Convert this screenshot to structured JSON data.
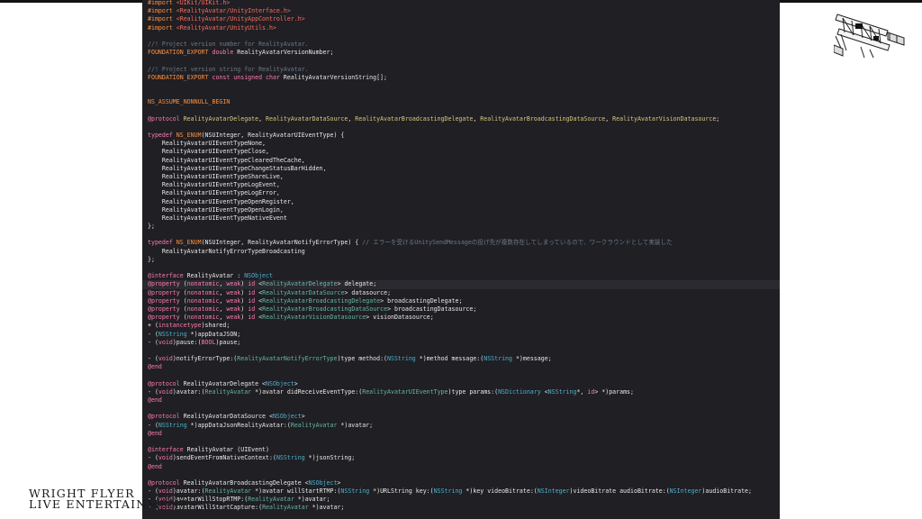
{
  "brand": {
    "line1": "WRIGHT FLYER",
    "line2": "LIVE ENTERTAINMENT"
  },
  "icons": {
    "logo": "biplane-logo-icon"
  },
  "colors": {
    "editor_bg": "#1f1f24",
    "keyword": "#ff7ab2",
    "macro": "#fd8f3f",
    "string": "#fc6a5d",
    "comment": "#6c7986",
    "type": "#4eb0cc",
    "class": "#d9c97c"
  },
  "code_lines": [
    [
      [
        "mac",
        "#import "
      ],
      [
        "str",
        "<UIKit/UIKit.h>"
      ]
    ],
    [
      [
        "mac",
        "#import "
      ],
      [
        "str",
        "<RealityAvatar/UnityInterface.h>"
      ]
    ],
    [
      [
        "mac",
        "#import "
      ],
      [
        "str",
        "<RealityAvatar/UnityAppController.h>"
      ]
    ],
    [
      [
        "mac",
        "#import "
      ],
      [
        "str",
        "<RealityAvatar/UnityUtils.h>"
      ]
    ],
    [],
    [
      [
        "cmt",
        "//! Project version number for RealityAvatar."
      ]
    ],
    [
      [
        "mac",
        "FOUNDATION_EXPORT "
      ],
      [
        "kw",
        "double "
      ],
      [
        "pl",
        "RealityAvatarVersionNumber;"
      ]
    ],
    [],
    [
      [
        "cmt",
        "//! Project version string for RealityAvatar."
      ]
    ],
    [
      [
        "mac",
        "FOUNDATION_EXPORT "
      ],
      [
        "kw",
        "const unsigned char "
      ],
      [
        "pl",
        "RealityAvatarVersionString[];"
      ]
    ],
    [],
    [],
    [
      [
        "mac",
        "NS_ASSUME_NONNULL_BEGIN"
      ]
    ],
    [],
    [
      [
        "kw",
        "@protocol "
      ],
      [
        "cls",
        "RealityAvatarDelegate"
      ],
      [
        "pl",
        ", "
      ],
      [
        "cls",
        "RealityAvatarDataSource"
      ],
      [
        "pl",
        ", "
      ],
      [
        "cls",
        "RealityAvatarBroadcastingDelegate"
      ],
      [
        "pl",
        ", "
      ],
      [
        "cls",
        "RealityAvatarBroadcastingDataSource"
      ],
      [
        "pl",
        ", "
      ],
      [
        "cls",
        "RealityAvatarVisionDatasource"
      ],
      [
        "pl",
        ";"
      ]
    ],
    [],
    [
      [
        "kw",
        "typedef "
      ],
      [
        "mac",
        "NS_ENUM"
      ],
      [
        "pl",
        "(NSUInteger, RealityAvatarUIEventType) {"
      ]
    ],
    [
      [
        "pl",
        "    RealityAvatarUIEventTypeNone,"
      ]
    ],
    [
      [
        "pl",
        "    RealityAvatarUIEventTypeClose,"
      ]
    ],
    [
      [
        "pl",
        "    RealityAvatarUIEventTypeClearedTheCache,"
      ]
    ],
    [
      [
        "pl",
        "    RealityAvatarUIEventTypeChangeStatusBarHidden,"
      ]
    ],
    [
      [
        "pl",
        "    RealityAvatarUIEventTypeShareLive,"
      ]
    ],
    [
      [
        "pl",
        "    RealityAvatarUIEventTypeLogEvent,"
      ]
    ],
    [
      [
        "pl",
        "    RealityAvatarUIEventTypeLogError,"
      ]
    ],
    [
      [
        "pl",
        "    RealityAvatarUIEventTypeOpenRegister,"
      ]
    ],
    [
      [
        "pl",
        "    RealityAvatarUIEventTypeOpenLogin,"
      ]
    ],
    [
      [
        "pl",
        "    RealityAvatarUIEventTypeNativeEvent"
      ]
    ],
    [
      [
        "pl",
        "};"
      ]
    ],
    [],
    [
      [
        "kw",
        "typedef "
      ],
      [
        "mac",
        "NS_ENUM"
      ],
      [
        "pl",
        "(NSUInteger, RealityAvatarNotifyErrorType) { "
      ],
      [
        "cmt",
        "// エラーを受けるUnitySendMessageの投げ先が複数存在してしまっているので、ワークラウンドとして実装した"
      ]
    ],
    [
      [
        "pl",
        "    RealityAvatarNotifyErrorTypeBroadcasting"
      ]
    ],
    [
      [
        "pl",
        "};"
      ]
    ],
    [],
    [
      [
        "kw",
        "@interface "
      ],
      [
        "pl",
        "RealityAvatar : "
      ],
      [
        "typ",
        "NSObject"
      ]
    ],
    [
      [
        "kw",
        "@property "
      ],
      [
        "pl",
        "("
      ],
      [
        "kw",
        "nonatomic"
      ],
      [
        "pl",
        ", "
      ],
      [
        "kw",
        "weak"
      ],
      [
        "pl",
        ") "
      ],
      [
        "kw",
        "id "
      ],
      [
        "pl",
        "<"
      ],
      [
        "prj",
        "RealityAvatarDelegate"
      ],
      [
        "pl",
        "> delegate;"
      ]
    ],
    [
      [
        "kw",
        "@property "
      ],
      [
        "pl",
        "("
      ],
      [
        "kw",
        "nonatomic"
      ],
      [
        "pl",
        ", "
      ],
      [
        "kw",
        "weak"
      ],
      [
        "pl",
        ") "
      ],
      [
        "kw",
        "id "
      ],
      [
        "pl",
        "<"
      ],
      [
        "prj",
        "RealityAvatarDataSource"
      ],
      [
        "pl",
        "> datasource;"
      ]
    ],
    [
      [
        "kw",
        "@property "
      ],
      [
        "pl",
        "("
      ],
      [
        "kw",
        "nonatomic"
      ],
      [
        "pl",
        ", "
      ],
      [
        "kw",
        "weak"
      ],
      [
        "pl",
        ") "
      ],
      [
        "kw",
        "id "
      ],
      [
        "pl",
        "<"
      ],
      [
        "prj",
        "RealityAvatarBroadcastingDelegate"
      ],
      [
        "pl",
        "> broadcastingDelegate;"
      ]
    ],
    [
      [
        "kw",
        "@property "
      ],
      [
        "pl",
        "("
      ],
      [
        "kw",
        "nonatomic"
      ],
      [
        "pl",
        ", "
      ],
      [
        "kw",
        "weak"
      ],
      [
        "pl",
        ") "
      ],
      [
        "kw",
        "id "
      ],
      [
        "pl",
        "<"
      ],
      [
        "prj",
        "RealityAvatarBroadcastingDataSource"
      ],
      [
        "pl",
        "> broadcastingDatasource;"
      ]
    ],
    [
      [
        "kw",
        "@property "
      ],
      [
        "pl",
        "("
      ],
      [
        "kw",
        "nonatomic"
      ],
      [
        "pl",
        ", "
      ],
      [
        "kw",
        "weak"
      ],
      [
        "pl",
        ") "
      ],
      [
        "kw",
        "id "
      ],
      [
        "pl",
        "<"
      ],
      [
        "prj",
        "RealityAvatarVisionDatasource"
      ],
      [
        "pl",
        "> visionDatasource;"
      ]
    ],
    [
      [
        "pl",
        "+ ("
      ],
      [
        "kw",
        "instancetype"
      ],
      [
        "pl",
        ")shared;"
      ]
    ],
    [
      [
        "pl",
        "- ("
      ],
      [
        "typ",
        "NSString "
      ],
      [
        "pl",
        "*)appDataJSON;"
      ]
    ],
    [
      [
        "pl",
        "- ("
      ],
      [
        "kw",
        "void"
      ],
      [
        "pl",
        ")pause:("
      ],
      [
        "kw",
        "BOOL"
      ],
      [
        "pl",
        ")pause;"
      ]
    ],
    [],
    [
      [
        "pl",
        "- ("
      ],
      [
        "kw",
        "void"
      ],
      [
        "pl",
        ")notifyErrorType:("
      ],
      [
        "prj",
        "RealityAvatarNotifyErrorType"
      ],
      [
        "pl",
        ")type method:("
      ],
      [
        "typ",
        "NSString "
      ],
      [
        "pl",
        "*)method message:("
      ],
      [
        "typ",
        "NSString "
      ],
      [
        "pl",
        "*)message;"
      ]
    ],
    [
      [
        "kw",
        "@end"
      ]
    ],
    [],
    [
      [
        "kw",
        "@protocol "
      ],
      [
        "pl",
        "RealityAvatarDelegate <"
      ],
      [
        "typ",
        "NSObject"
      ],
      [
        "pl",
        ">"
      ]
    ],
    [
      [
        "pl",
        "- ("
      ],
      [
        "kw",
        "void"
      ],
      [
        "pl",
        ")avatar:("
      ],
      [
        "prj",
        "RealityAvatar "
      ],
      [
        "pl",
        "*)avatar didReceiveEventType:("
      ],
      [
        "prj",
        "RealityAvatarUIEventType"
      ],
      [
        "pl",
        ")type params:("
      ],
      [
        "typ",
        "NSDictionary "
      ],
      [
        "pl",
        "<"
      ],
      [
        "typ",
        "NSString"
      ],
      [
        "pl",
        "*, "
      ],
      [
        "kw",
        "id"
      ],
      [
        "pl",
        "> *)params;"
      ]
    ],
    [
      [
        "kw",
        "@end"
      ]
    ],
    [],
    [
      [
        "kw",
        "@protocol "
      ],
      [
        "pl",
        "RealityAvatarDataSource <"
      ],
      [
        "typ",
        "NSObject"
      ],
      [
        "pl",
        ">"
      ]
    ],
    [
      [
        "pl",
        "- ("
      ],
      [
        "typ",
        "NSString "
      ],
      [
        "pl",
        "*)appDataJsonRealityAvatar:("
      ],
      [
        "prj",
        "RealityAvatar "
      ],
      [
        "pl",
        "*)avatar;"
      ]
    ],
    [
      [
        "kw",
        "@end"
      ]
    ],
    [],
    [
      [
        "kw",
        "@interface "
      ],
      [
        "pl",
        "RealityAvatar (UIEvent)"
      ]
    ],
    [
      [
        "pl",
        "- ("
      ],
      [
        "kw",
        "void"
      ],
      [
        "pl",
        ")sendEventFromNativeContext:("
      ],
      [
        "typ",
        "NSString "
      ],
      [
        "pl",
        "*)jsonString;"
      ]
    ],
    [
      [
        "kw",
        "@end"
      ]
    ],
    [],
    [
      [
        "kw",
        "@protocol "
      ],
      [
        "pl",
        "RealityAvatarBroadcastingDelegate <"
      ],
      [
        "typ",
        "NSObject"
      ],
      [
        "pl",
        ">"
      ]
    ],
    [
      [
        "pl",
        "- ("
      ],
      [
        "kw",
        "void"
      ],
      [
        "pl",
        ")avatar:("
      ],
      [
        "prj",
        "RealityAvatar "
      ],
      [
        "pl",
        "*)avatar willStartRTMP:("
      ],
      [
        "typ",
        "NSString "
      ],
      [
        "pl",
        "*)URLString key:("
      ],
      [
        "typ",
        "NSString "
      ],
      [
        "pl",
        "*)key videoBitrate:("
      ],
      [
        "typ",
        "NSInteger"
      ],
      [
        "pl",
        ")videoBitrate audioBitrate:("
      ],
      [
        "typ",
        "NSInteger"
      ],
      [
        "pl",
        ")audioBitrate;"
      ]
    ],
    [
      [
        "pl",
        "- ("
      ],
      [
        "kw",
        "void"
      ],
      [
        "pl",
        ")avatarWillStopRTMP:("
      ],
      [
        "prj",
        "RealityAvatar "
      ],
      [
        "pl",
        "*)avatar;"
      ]
    ],
    [
      [
        "pl",
        "- ("
      ],
      [
        "kw",
        "void"
      ],
      [
        "pl",
        ")avatarWillStartCapture:("
      ],
      [
        "prj",
        "RealityAvatar "
      ],
      [
        "pl",
        "*)avatar;"
      ]
    ]
  ],
  "highlighted_line_index": 34
}
